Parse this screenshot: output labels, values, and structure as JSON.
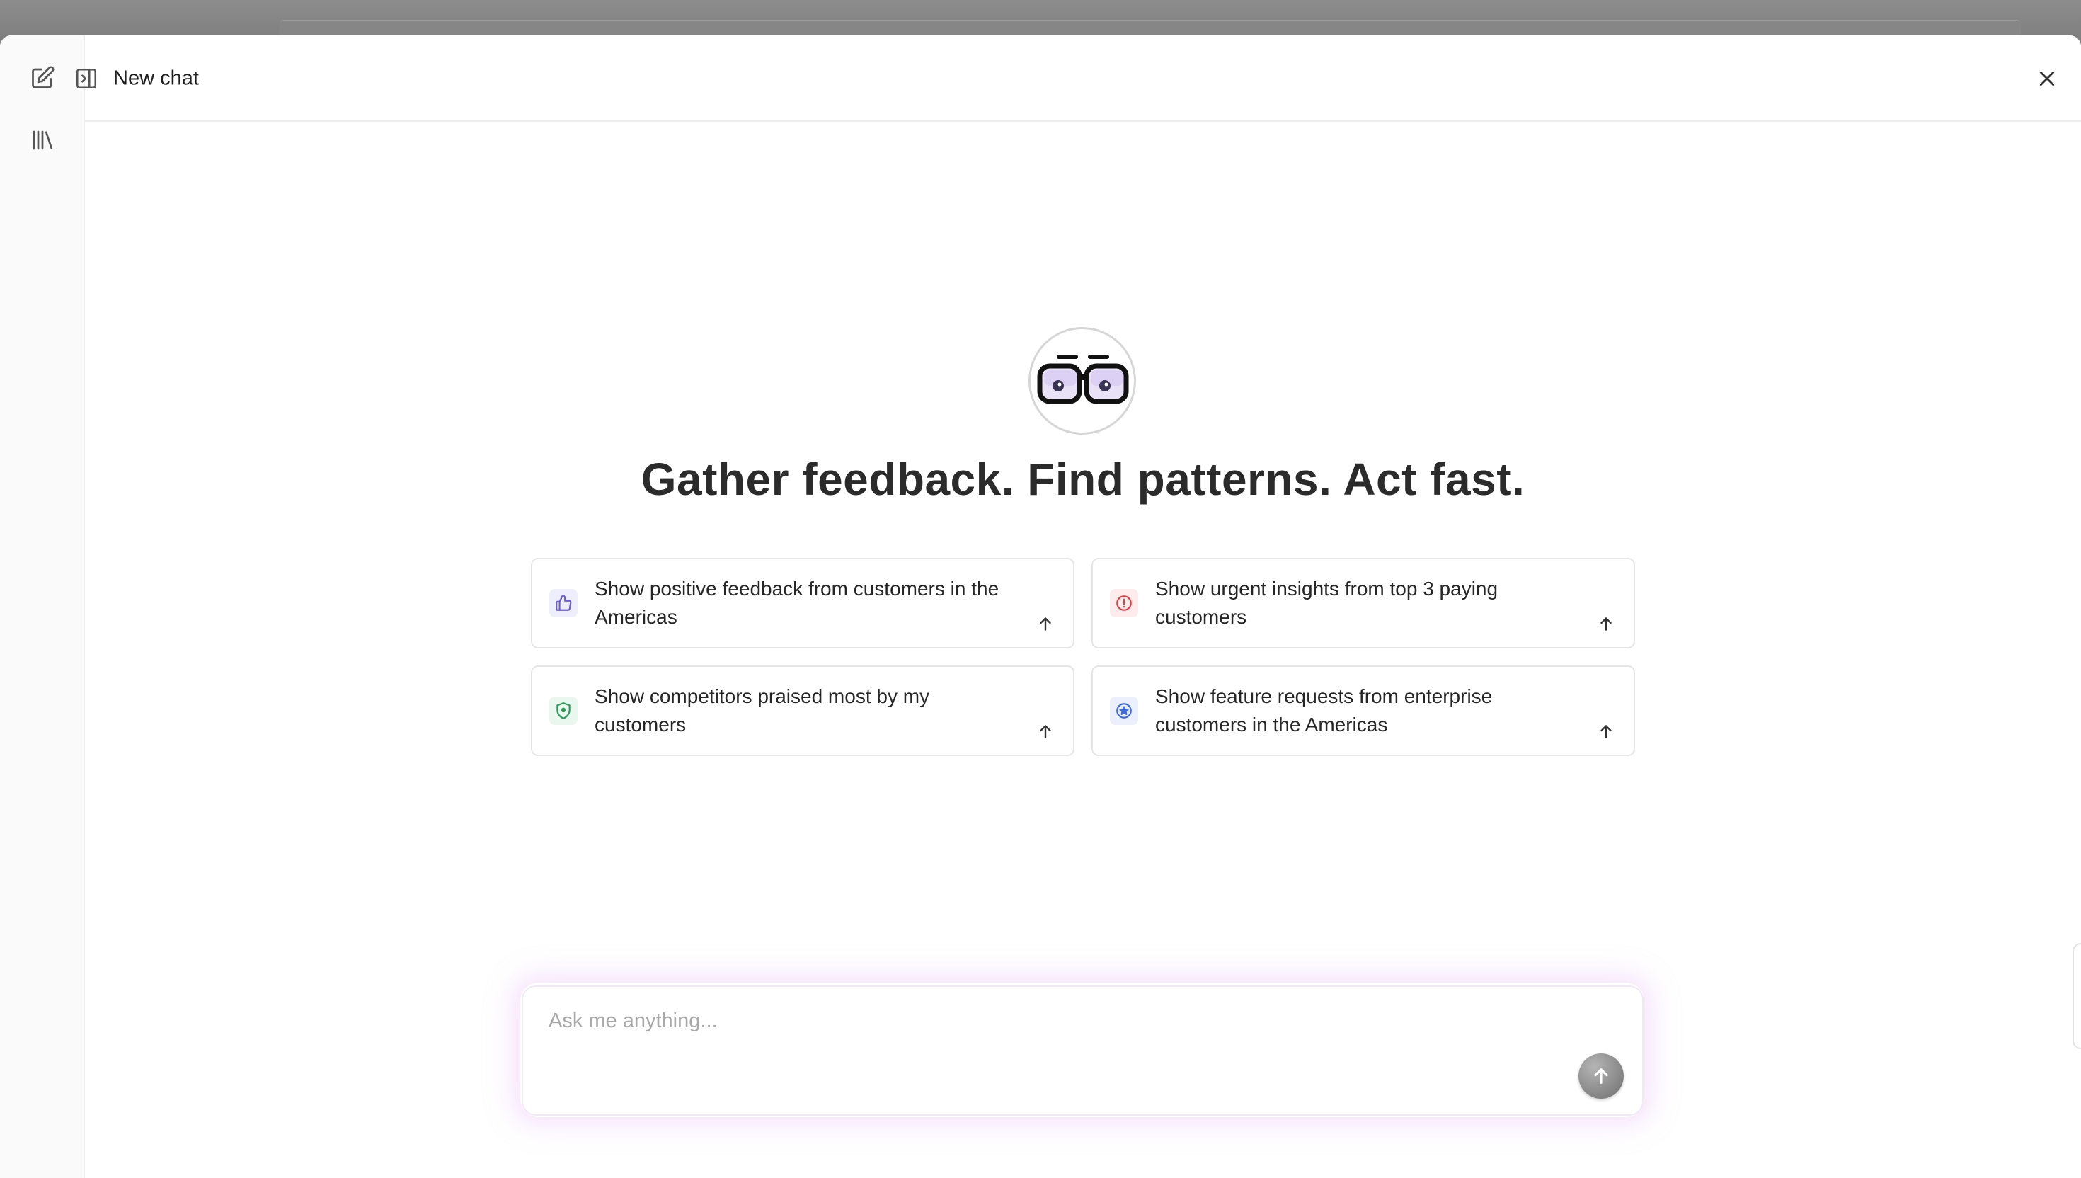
{
  "header": {
    "title": "New chat"
  },
  "rail": {
    "new_chat_icon": "edit-icon",
    "library_icon": "library-icon"
  },
  "hero": {
    "avatar_icon": "glasses-mascot-icon",
    "headline": "Gather feedback. Find patterns. Act fast."
  },
  "suggestions": [
    {
      "text": "Show positive feedback from customers in the Americas",
      "icon": "thumbs-up-icon",
      "accent": "#6b5bd6",
      "icon_bg": "#efeefc"
    },
    {
      "text": "Show urgent insights from top 3 paying customers",
      "icon": "alert-circle-icon",
      "accent": "#d9434b",
      "icon_bg": "#fdeceb"
    },
    {
      "text": "Show competitors praised most by my customers",
      "icon": "shield-icon",
      "accent": "#2e9a5a",
      "icon_bg": "#eaf7ef"
    },
    {
      "text": "Show feature requests from enterprise customers in the Americas",
      "icon": "star-badge-icon",
      "accent": "#3f6ad8",
      "icon_bg": "#ebf0fc"
    }
  ],
  "composer": {
    "placeholder": "Ask me anything...",
    "value": ""
  }
}
